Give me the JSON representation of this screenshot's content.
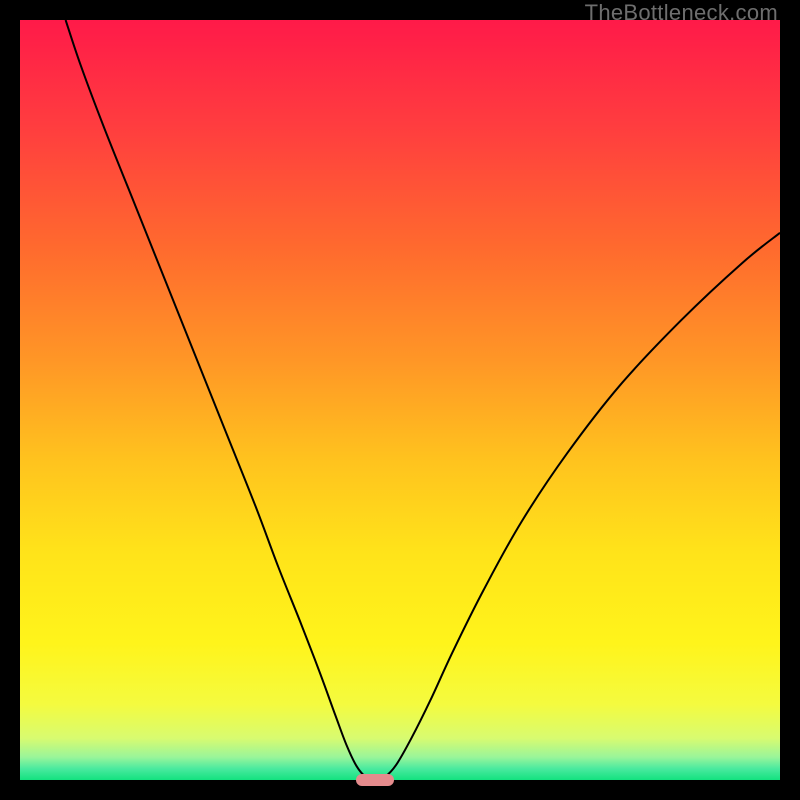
{
  "watermark": "TheBottleneck.com",
  "chart_data": {
    "type": "line",
    "title": "",
    "xlabel": "",
    "ylabel": "",
    "xlim": [
      0,
      100
    ],
    "ylim": [
      0,
      100
    ],
    "grid": false,
    "legend": false,
    "background_gradient_stops": [
      {
        "offset": 0.0,
        "color": "#ff1a49"
      },
      {
        "offset": 0.14,
        "color": "#ff3d3f"
      },
      {
        "offset": 0.3,
        "color": "#ff6a2e"
      },
      {
        "offset": 0.45,
        "color": "#ff9726"
      },
      {
        "offset": 0.58,
        "color": "#ffc31e"
      },
      {
        "offset": 0.7,
        "color": "#ffe31a"
      },
      {
        "offset": 0.82,
        "color": "#fff41b"
      },
      {
        "offset": 0.9,
        "color": "#f4fb3f"
      },
      {
        "offset": 0.945,
        "color": "#d8fb70"
      },
      {
        "offset": 0.97,
        "color": "#99f59a"
      },
      {
        "offset": 0.985,
        "color": "#4aea9f"
      },
      {
        "offset": 1.0,
        "color": "#13e27f"
      }
    ],
    "series": [
      {
        "name": "bottleneck-curve",
        "stroke": "#000000",
        "stroke_width": 2,
        "points": [
          {
            "x": 6.0,
            "y": 100.0
          },
          {
            "x": 8.0,
            "y": 94.0
          },
          {
            "x": 11.0,
            "y": 86.0
          },
          {
            "x": 15.0,
            "y": 76.0
          },
          {
            "x": 19.0,
            "y": 66.0
          },
          {
            "x": 23.0,
            "y": 56.0
          },
          {
            "x": 27.0,
            "y": 46.0
          },
          {
            "x": 31.0,
            "y": 36.0
          },
          {
            "x": 34.0,
            "y": 28.0
          },
          {
            "x": 37.0,
            "y": 20.5
          },
          {
            "x": 39.5,
            "y": 14.0
          },
          {
            "x": 41.5,
            "y": 8.5
          },
          {
            "x": 43.0,
            "y": 4.5
          },
          {
            "x": 44.3,
            "y": 1.8
          },
          {
            "x": 45.5,
            "y": 0.4
          },
          {
            "x": 46.7,
            "y": 0.0
          },
          {
            "x": 48.0,
            "y": 0.4
          },
          {
            "x": 49.5,
            "y": 2.0
          },
          {
            "x": 51.5,
            "y": 5.5
          },
          {
            "x": 54.0,
            "y": 10.5
          },
          {
            "x": 57.0,
            "y": 17.0
          },
          {
            "x": 61.0,
            "y": 25.0
          },
          {
            "x": 66.0,
            "y": 34.0
          },
          {
            "x": 72.0,
            "y": 43.0
          },
          {
            "x": 79.0,
            "y": 52.0
          },
          {
            "x": 87.0,
            "y": 60.5
          },
          {
            "x": 95.0,
            "y": 68.0
          },
          {
            "x": 100.0,
            "y": 72.0
          }
        ]
      }
    ],
    "marker": {
      "name": "optimum-marker",
      "x": 46.7,
      "y": 0.0,
      "shape": "pill",
      "color": "#e58b8d"
    }
  }
}
